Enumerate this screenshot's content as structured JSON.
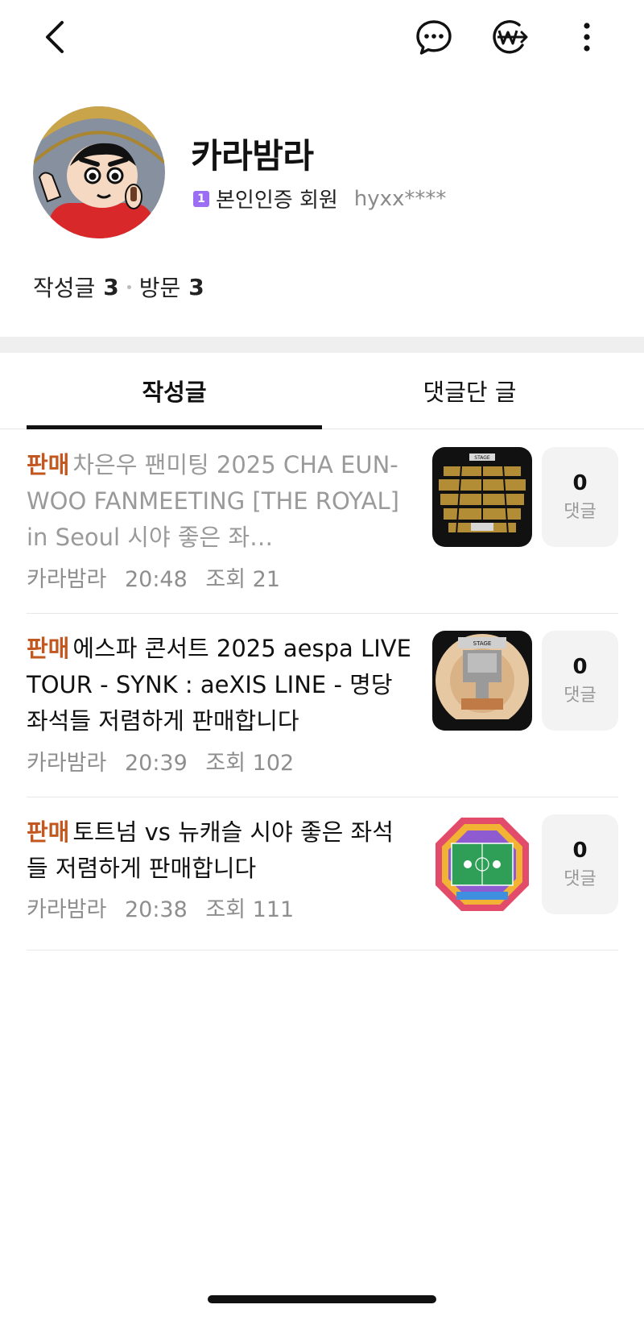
{
  "profile": {
    "nickname": "카라밤라",
    "verification": "본인인증 회원",
    "level_badge": "1",
    "user_id": "hyxx****",
    "posts_label": "작성글",
    "posts_count": "3",
    "visits_label": "방문",
    "visits_count": "3"
  },
  "tabs": [
    "작성글",
    "댓글단 글"
  ],
  "posts": [
    {
      "tag": "판매",
      "title": "차은우 팬미팅 2025 CHA EUN-WOO FANMEETING [THE ROYAL] in Seoul 시야 좋은 좌…",
      "author": "카라밤라",
      "time": "20:48",
      "views": "조회 21",
      "comments": "0",
      "comments_label": "댓글"
    },
    {
      "tag": "판매",
      "title": "에스파 콘서트 2025 aespa LIVE TOUR - SYNK : aeXIS LINE - 명당 좌석들 저렴하게 판매합니다",
      "author": "카라밤라",
      "time": "20:39",
      "views": "조회 102",
      "comments": "0",
      "comments_label": "댓글"
    },
    {
      "tag": "판매",
      "title": "토트넘 vs 뉴캐슬 시야 좋은 좌석들 저렴하게 판매합니다",
      "author": "카라밤라",
      "time": "20:38",
      "views": "조회 111",
      "comments": "0",
      "comments_label": "댓글"
    }
  ],
  "thumbnails": {
    "stage_label": "STAGE"
  },
  "icons": {
    "back": "back-arrow-icon",
    "chat": "chat-bubble-icon",
    "won": "won-pay-icon",
    "more": "more-vertical-icon"
  },
  "colors": {
    "sale_tag": "#c2581f",
    "level_badge": "#9b6ef3"
  }
}
